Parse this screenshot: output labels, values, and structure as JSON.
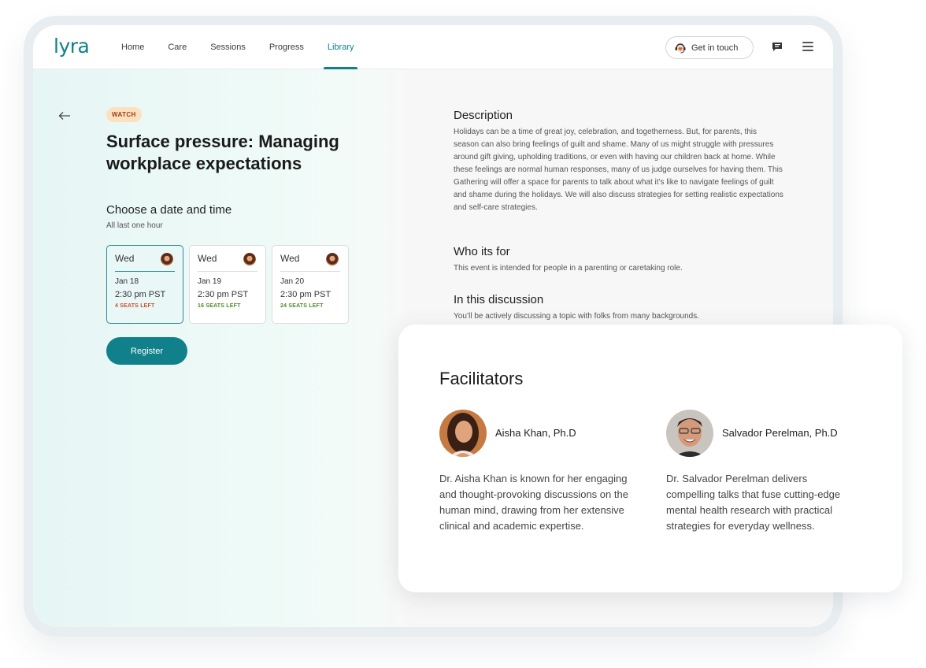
{
  "nav": {
    "logo": "lyra",
    "links": [
      {
        "label": "Home",
        "active": false
      },
      {
        "label": "Care",
        "active": false
      },
      {
        "label": "Sessions",
        "active": false
      },
      {
        "label": "Progress",
        "active": false
      },
      {
        "label": "Library",
        "active": true
      }
    ],
    "get_in_touch": "Get in touch",
    "icons": {
      "headset": "headset-heart-icon",
      "chat": "chat-icon",
      "menu": "hamburger-menu-icon"
    }
  },
  "event": {
    "badge": "WATCH",
    "title": "Surface pressure: Managing workplace expectations",
    "choose_title": "Choose a date and time",
    "choose_sub": "All last one hour",
    "slots": [
      {
        "day": "Wed",
        "date": "Jan 18",
        "time": "2:30 pm PST",
        "seats": "4 SEATS LEFT",
        "seats_color": "#c2552b",
        "selected": true
      },
      {
        "day": "Wed",
        "date": "Jan 19",
        "time": "2:30 pm PST",
        "seats": "16 SEATS LEFT",
        "seats_color": "#4f8a2a",
        "selected": false
      },
      {
        "day": "Wed",
        "date": "Jan 20",
        "time": "2:30 pm PST",
        "seats": "24 SEATS LEFT",
        "seats_color": "#4f8a2a",
        "selected": false
      }
    ],
    "register": "Register"
  },
  "details": {
    "description_title": "Description",
    "description_text": "Holidays can be a time of great joy, celebration, and togetherness. But, for parents, this season can also bring feelings of guilt and shame. Many of us might struggle with pressures around gift giving, upholding traditions, or even with having our children back at home. While these feelings are normal human responses, many of us judge ourselves for having them. This Gathering will offer a space for parents to talk about what it’s like to navigate feelings of guilt and shame during the holidays. We will also discuss strategies for setting realistic expectations and self-care strategies.",
    "who_title": "Who its for",
    "who_text": "This event is intended for people in a parenting or caretaking role.",
    "discussion_title": "In this discussion",
    "discussion_text": "You’ll be actively discussing a topic with folks from many backgrounds."
  },
  "facilitators": {
    "title": "Facilitators",
    "people": [
      {
        "name": "Aisha Khan, Ph.D",
        "bio": "Dr. Aisha Khan is known for her engaging and thought-provoking discussions on the human mind, drawing from her extensive clinical and academic expertise."
      },
      {
        "name": "Salvador Perelman, Ph.D",
        "bio": "Dr. Salvador Perelman delivers compelling talks that fuse cutting-edge mental health research with practical strategies for everyday wellness."
      }
    ]
  },
  "colors": {
    "brand": "#10808a",
    "badge_bg": "#fde1bf",
    "badge_text": "#9b3b1b"
  }
}
